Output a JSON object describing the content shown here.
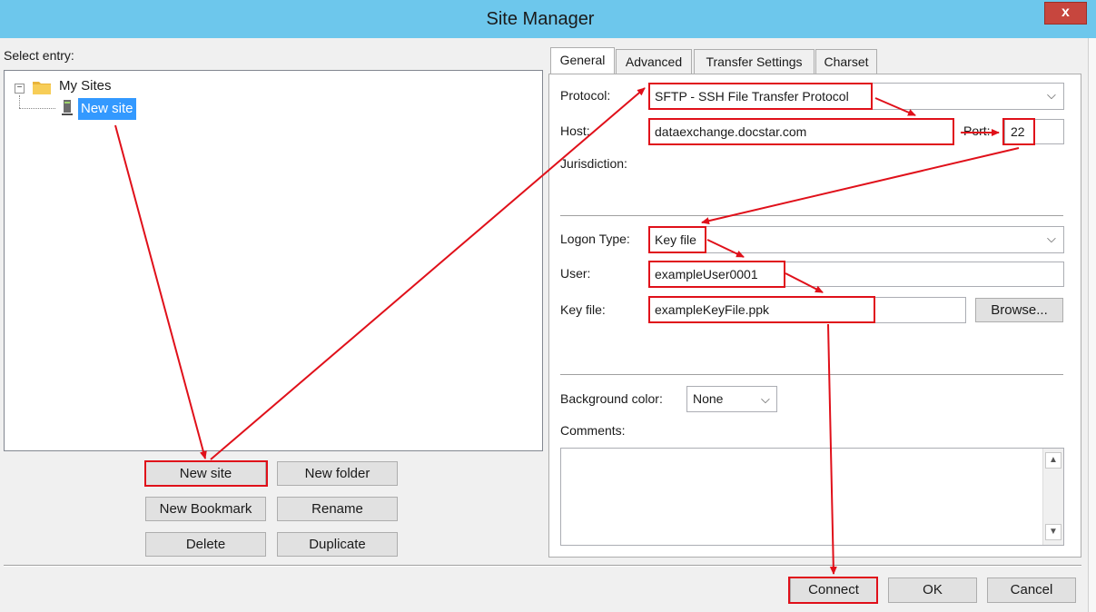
{
  "window": {
    "title": "Site Manager",
    "close_glyph": "x"
  },
  "tree": {
    "label": "Select entry:",
    "expander": "−",
    "root": {
      "label": "My Sites",
      "icon": "folder-icon"
    },
    "child": {
      "label": "New site",
      "icon": "server-icon"
    }
  },
  "buttons": {
    "new_site": "New site",
    "new_folder": "New folder",
    "new_bookmark": "New Bookmark",
    "rename": "Rename",
    "delete": "Delete",
    "duplicate": "Duplicate",
    "browse": "Browse...",
    "connect": "Connect",
    "ok": "OK",
    "cancel": "Cancel"
  },
  "tabs": [
    "General",
    "Advanced",
    "Transfer Settings",
    "Charset"
  ],
  "general": {
    "protocol_label": "Protocol:",
    "protocol_value": "SFTP - SSH File Transfer Protocol",
    "host_label": "Host:",
    "host_value": "dataexchange.docstar.com",
    "port_label": "Port:",
    "port_value": "22",
    "jurisdiction_label": "Jurisdiction:",
    "logon_label": "Logon Type:",
    "logon_value": "Key file",
    "user_label": "User:",
    "user_value": "exampleUser0001",
    "keyfile_label": "Key file:",
    "keyfile_value": "exampleKeyFile.ppk",
    "bg_label": "Background color:",
    "bg_value": "None",
    "comments_label": "Comments:"
  },
  "colors": {
    "annotation": "#e0101a",
    "titlebar": "#6dc7ec",
    "selection": "#3399ff"
  }
}
